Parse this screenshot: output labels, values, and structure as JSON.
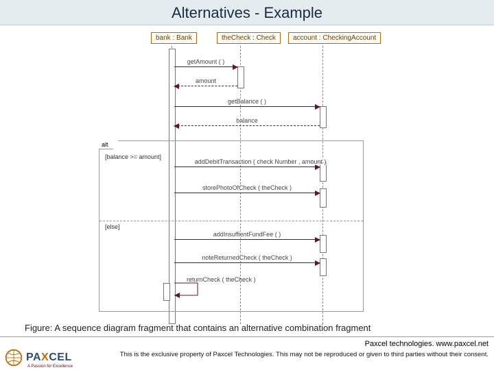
{
  "title": "Alternatives - Example",
  "caption": "Figure: A sequence diagram fragment that contains an alternative combination fragment",
  "lifelines": {
    "bank": "bank : Bank",
    "check": "theCheck : Check",
    "account": "account : CheckingAccount"
  },
  "fragment": {
    "operator": "alt",
    "guard_if": "[balance >= amount]",
    "guard_else": "[else]"
  },
  "messages": {
    "m1": "getAmount ( )",
    "r1": "amount",
    "m2": "getBalance ( )",
    "r2": "balance",
    "m3": "addDebitTransaction ( check Number , amount )",
    "m4": "storePhotoOfCheck ( theCheck )",
    "m5": "addInsuffientFundFee ( )",
    "m6": "noteReturnedCheck ( theCheck )",
    "m7": "returnCheck ( theCheck )"
  },
  "footer": {
    "line1": "Paxcel technologies. www.paxcel.net",
    "line2": "This is the exclusive property of Paxcel Technologies. This may not be reproduced or given to third parties without their consent.",
    "brand_p": "P",
    "brand_a": "A",
    "brand_x": "X",
    "brand_c": "CEL",
    "brand_tag": "A Passion for Excellence"
  },
  "lifeline_x": {
    "bank": 250,
    "check": 350,
    "account": 470
  },
  "colors": {
    "title_bg": "#e4ecef",
    "msg": "#6b0f2b",
    "head_border": "#b26b00"
  }
}
